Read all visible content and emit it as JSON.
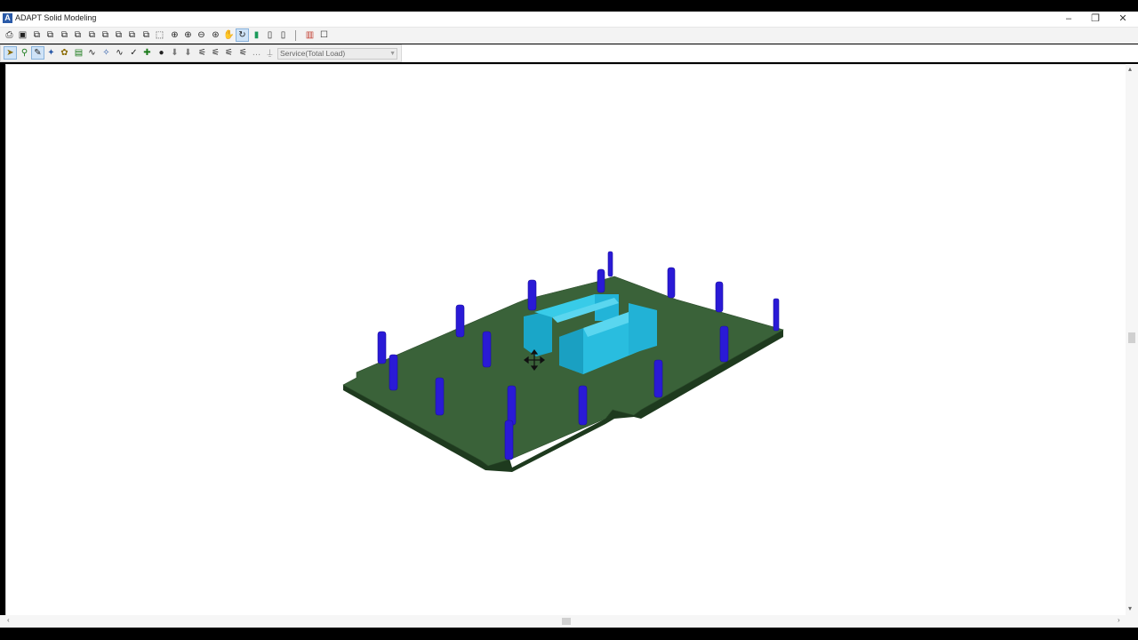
{
  "window": {
    "title": "ADAPT Solid Modeling",
    "app_icon": "A",
    "minimize_glyph": "–",
    "restore_glyph": "❐",
    "close_glyph": "✕"
  },
  "toolbar1": {
    "icons": [
      "print-icon",
      "camera-icon",
      "view-3d-icon",
      "view-top-icon",
      "view-bottom-icon",
      "view-front-icon",
      "view-back-icon",
      "view-left-icon",
      "view-right-icon",
      "view-iso-icon",
      "zoom-window-icon",
      "zoom-icon",
      "zoom-in-icon",
      "zoom-out-icon",
      "zoom-extents-icon",
      "pan-icon",
      "rotate-icon",
      "color-bar-icon",
      "section-icon",
      "panel-icon",
      "legend-icon",
      "frame-icon"
    ]
  },
  "toolbar2": {
    "icons": [
      "select-icon",
      "node-icon",
      "edit-icon",
      "tendon-icon",
      "lock-icon",
      "display-icon",
      "deflection-icon",
      "stress-icon",
      "check-icon",
      "move-icon",
      "play-icon",
      "load-icon",
      "load-combo-icon",
      "reaction-icon",
      "reaction2-icon",
      "reaction3-icon",
      "reaction4-icon",
      "blank-icon",
      "settings-icon"
    ],
    "load_combo": {
      "selected": "Service(Total Load)"
    }
  },
  "scene": {
    "slab_color": "#3a6239",
    "column_color": "#2a1ad6",
    "wall_color": "#27bde0"
  },
  "scrollbars": {
    "left_arrow": "‹",
    "right_arrow": "›",
    "up_arrow": "▴",
    "down_arrow": "▾"
  }
}
